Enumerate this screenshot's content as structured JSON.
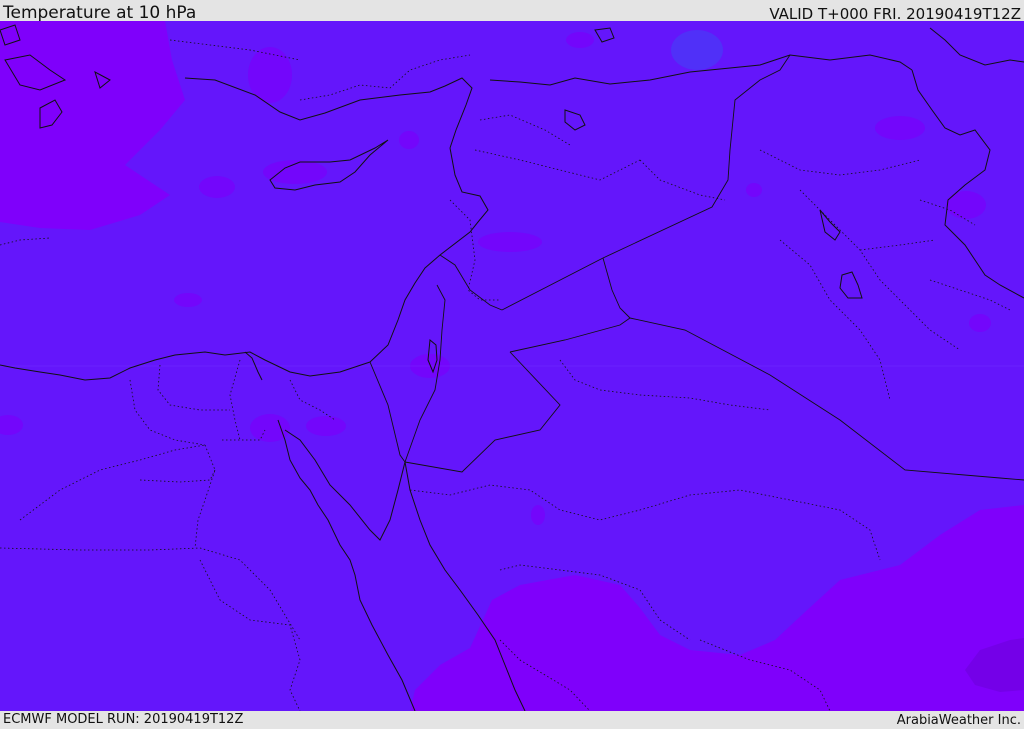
{
  "header": {
    "title": "Temperature at 10 hPa",
    "valid": "VALID T+000 FRI. 20190419T12Z"
  },
  "footer": {
    "model_run": "ECMWF MODEL RUN: 20190419T12Z",
    "brand": "ArabiaWeather Inc."
  },
  "colors": {
    "field_main": "#6416fb",
    "field_warm": "#7f00fb",
    "field_cool": "#5030f8",
    "field_deep": "#7400e8",
    "coastline": "#111111",
    "bars": "#e4e4e4"
  }
}
